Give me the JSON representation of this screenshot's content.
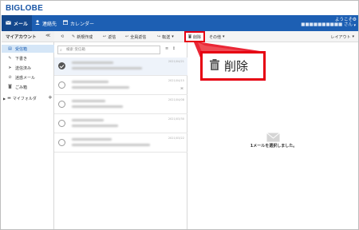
{
  "header": {
    "logo": "BIGLOBE",
    "welcome_line1": "ようこそ",
    "welcome_line2": "■■■■■■■■■■ さん"
  },
  "nav": {
    "mail": "メール",
    "contacts": "連絡先",
    "calendar": "カレンダー"
  },
  "sidebar": {
    "title": "マイアカウント",
    "collapse": "≪",
    "folders": [
      {
        "label": "受信箱",
        "icon": "inbox-icon"
      },
      {
        "label": "下書き",
        "icon": "draft-icon"
      },
      {
        "label": "送信済み",
        "icon": "sent-icon"
      },
      {
        "label": "迷惑メール",
        "icon": "spam-icon"
      },
      {
        "label": "ごみ箱",
        "icon": "trash-icon"
      }
    ],
    "my_folder": "マイフォルダ"
  },
  "toolbar": {
    "new": "新規作成",
    "reply": "返信",
    "reply_all": "全員返信",
    "forward": "転送",
    "delete": "削除",
    "more": "その他",
    "layout": "レイアウト"
  },
  "list": {
    "search_placeholder": "検索 受信箱",
    "rows": [
      {
        "date": "2021/04/21"
      },
      {
        "date": "2021/04/15"
      },
      {
        "date": "2021/04/08"
      },
      {
        "date": "2021/03/30"
      },
      {
        "date": "2021/03/22"
      }
    ]
  },
  "pane": {
    "empty_message": "1メールを選択しました。"
  },
  "callout": {
    "label": "削除"
  }
}
